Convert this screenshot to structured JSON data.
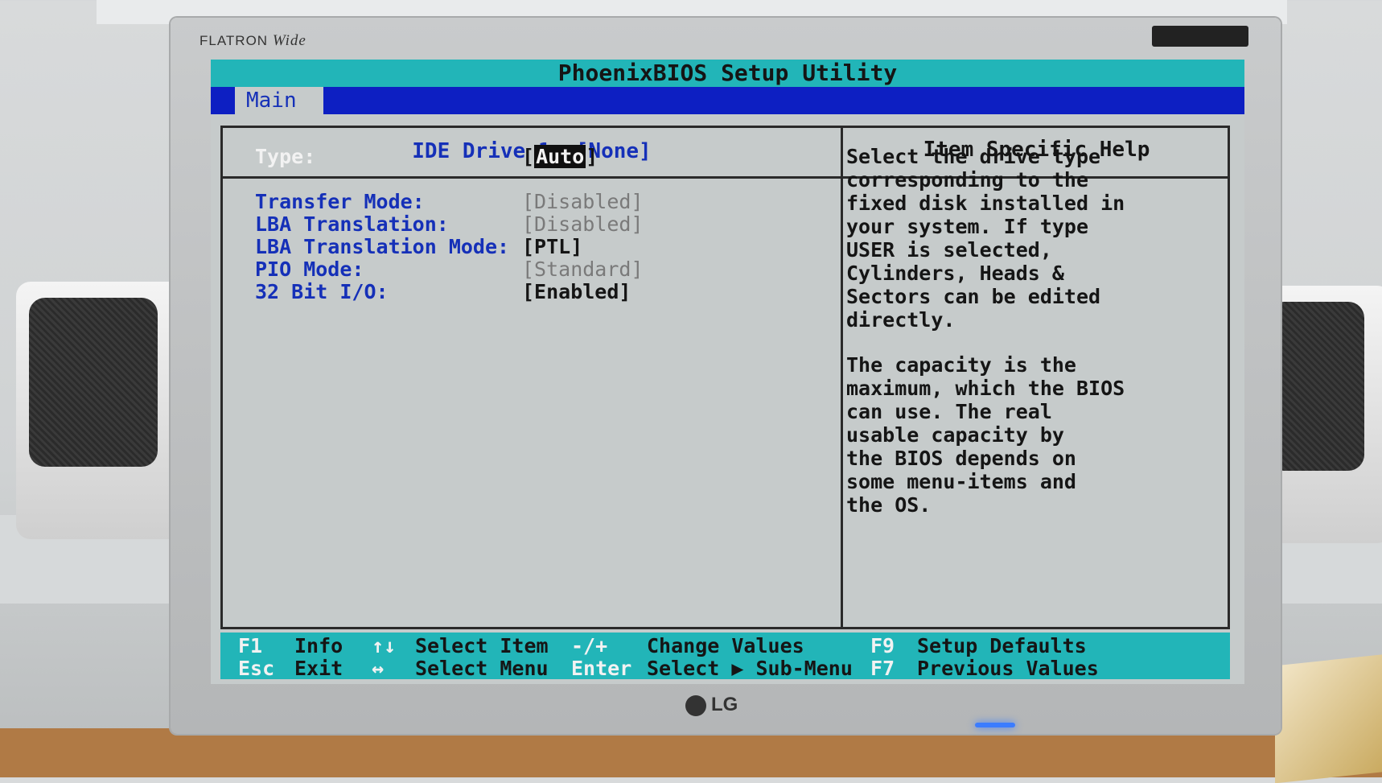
{
  "monitor": {
    "brand": "FLATRON",
    "brand_suffix": "Wide",
    "logo": "LG"
  },
  "bios": {
    "title": "PhoenixBIOS Setup Utility",
    "menu": {
      "active_tab": "Main"
    },
    "drive_header": "IDE Drive 1:  [None]",
    "help_header": "Item Specific Help",
    "settings": [
      {
        "label": "Type:",
        "value": "Auto",
        "state": "selected"
      },
      {
        "label": "Transfer Mode:",
        "value": "[Disabled]",
        "state": "disabled"
      },
      {
        "label": "LBA Translation:",
        "value": "[Disabled]",
        "state": "disabled"
      },
      {
        "label": "LBA Translation Mode:",
        "value": "[PTL]",
        "state": "enabled"
      },
      {
        "label": "PIO Mode:",
        "value": "[Standard]",
        "state": "disabled"
      },
      {
        "label": "32 Bit I/O:",
        "value": "[Enabled]",
        "state": "enabled"
      }
    ],
    "help_paragraphs": [
      [
        "Select the drive type",
        "corresponding to the",
        "fixed disk installed in",
        "your system. If type",
        "USER is selected,",
        "Cylinders, Heads &",
        "Sectors can be edited",
        "directly."
      ],
      [
        "The capacity is the",
        "maximum, which the BIOS",
        "can use. The real",
        "usable capacity by",
        "the BIOS depends on",
        "some menu-items and",
        "the OS."
      ]
    ],
    "footer": {
      "f1_key": "F1",
      "f1_desc": "Info",
      "esc_key": "Esc",
      "esc_desc": "Exit",
      "updown_key": "↑↓",
      "updown_desc": "Select Item",
      "leftright_key": "↔",
      "leftright_desc": "Select Menu",
      "change_key": "-/+",
      "change_desc": "Change Values",
      "enter_key": "Enter",
      "enter_desc": "Select ▶ Sub-Menu",
      "f9_key": "F9",
      "f9_desc": "Setup Defaults",
      "f7_key": "F7",
      "f7_desc": "Previous Values"
    }
  }
}
